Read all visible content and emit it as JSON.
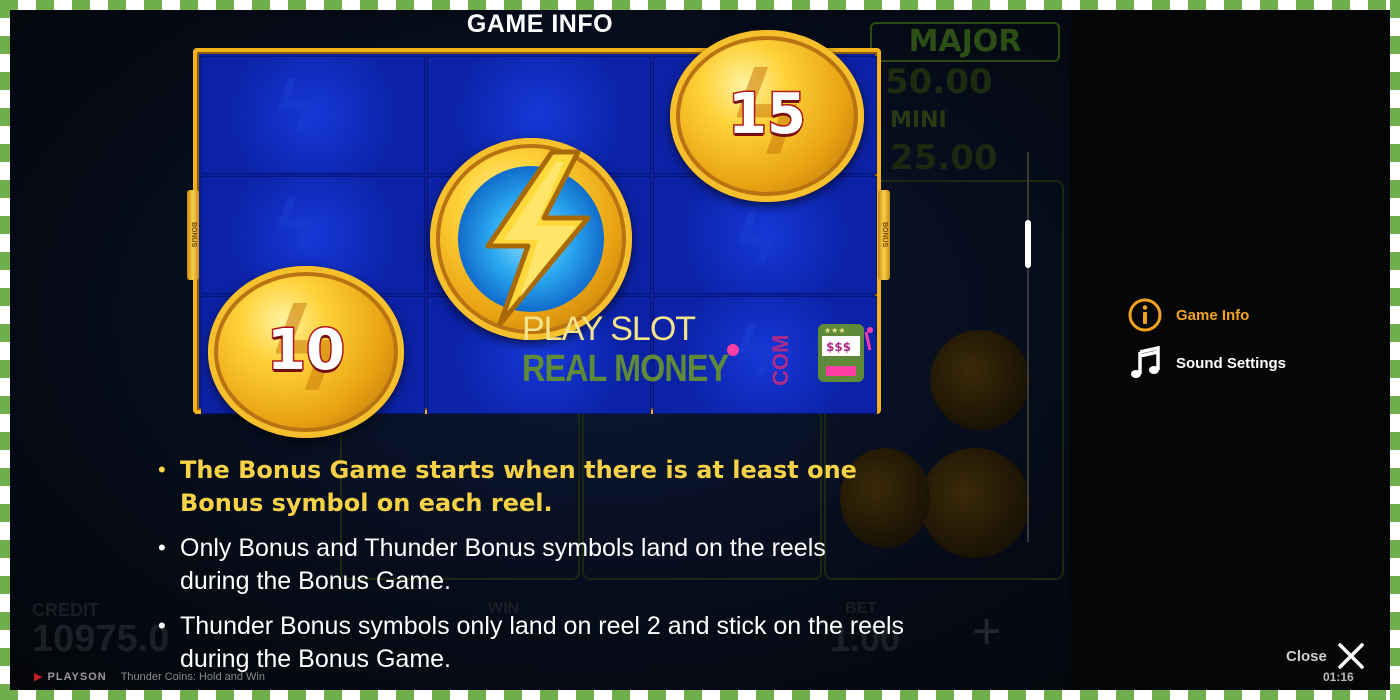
{
  "title": "GAME INFO",
  "coins": {
    "left_value": "10",
    "right_value": "15"
  },
  "side_tab_label": "BONUS",
  "watermark": {
    "line1": "PLAY SLOT",
    "line2": "REAL MONEY",
    "com": "COM"
  },
  "bullets": [
    "The Bonus Game starts when there is at least one Bonus symbol on each reel.",
    "Only Bonus and Thunder Bonus symbols land on the reels during the Bonus Game.",
    "Thunder Bonus symbols only land on reel 2 and stick on the reels during the Bonus Game."
  ],
  "menu": [
    {
      "label": "Game Info",
      "icon": "info-icon",
      "active": true
    },
    {
      "label": "Sound Settings",
      "icon": "music-note-icon",
      "active": false
    }
  ],
  "close_label": "Close",
  "clock": "01:16",
  "background": {
    "jackpot_major_label": "MAJOR",
    "jackpot_major_value": "50.00",
    "jackpot_mini_label": "MINI",
    "jackpot_mini_value": "25.00",
    "credit_label": "CREDIT",
    "credit_value": "10975.0",
    "win_label": "WIN",
    "bet_label": "BET",
    "bet_value": "1.00",
    "provider": "PLAYSON",
    "game_name": "Thunder Coins: Hold and Win"
  },
  "colors": {
    "accent": "#f2a21c",
    "highlight_text": "#f8d246",
    "reel_bg": "#0c22a6",
    "frame_gold": "#f2b31c"
  }
}
